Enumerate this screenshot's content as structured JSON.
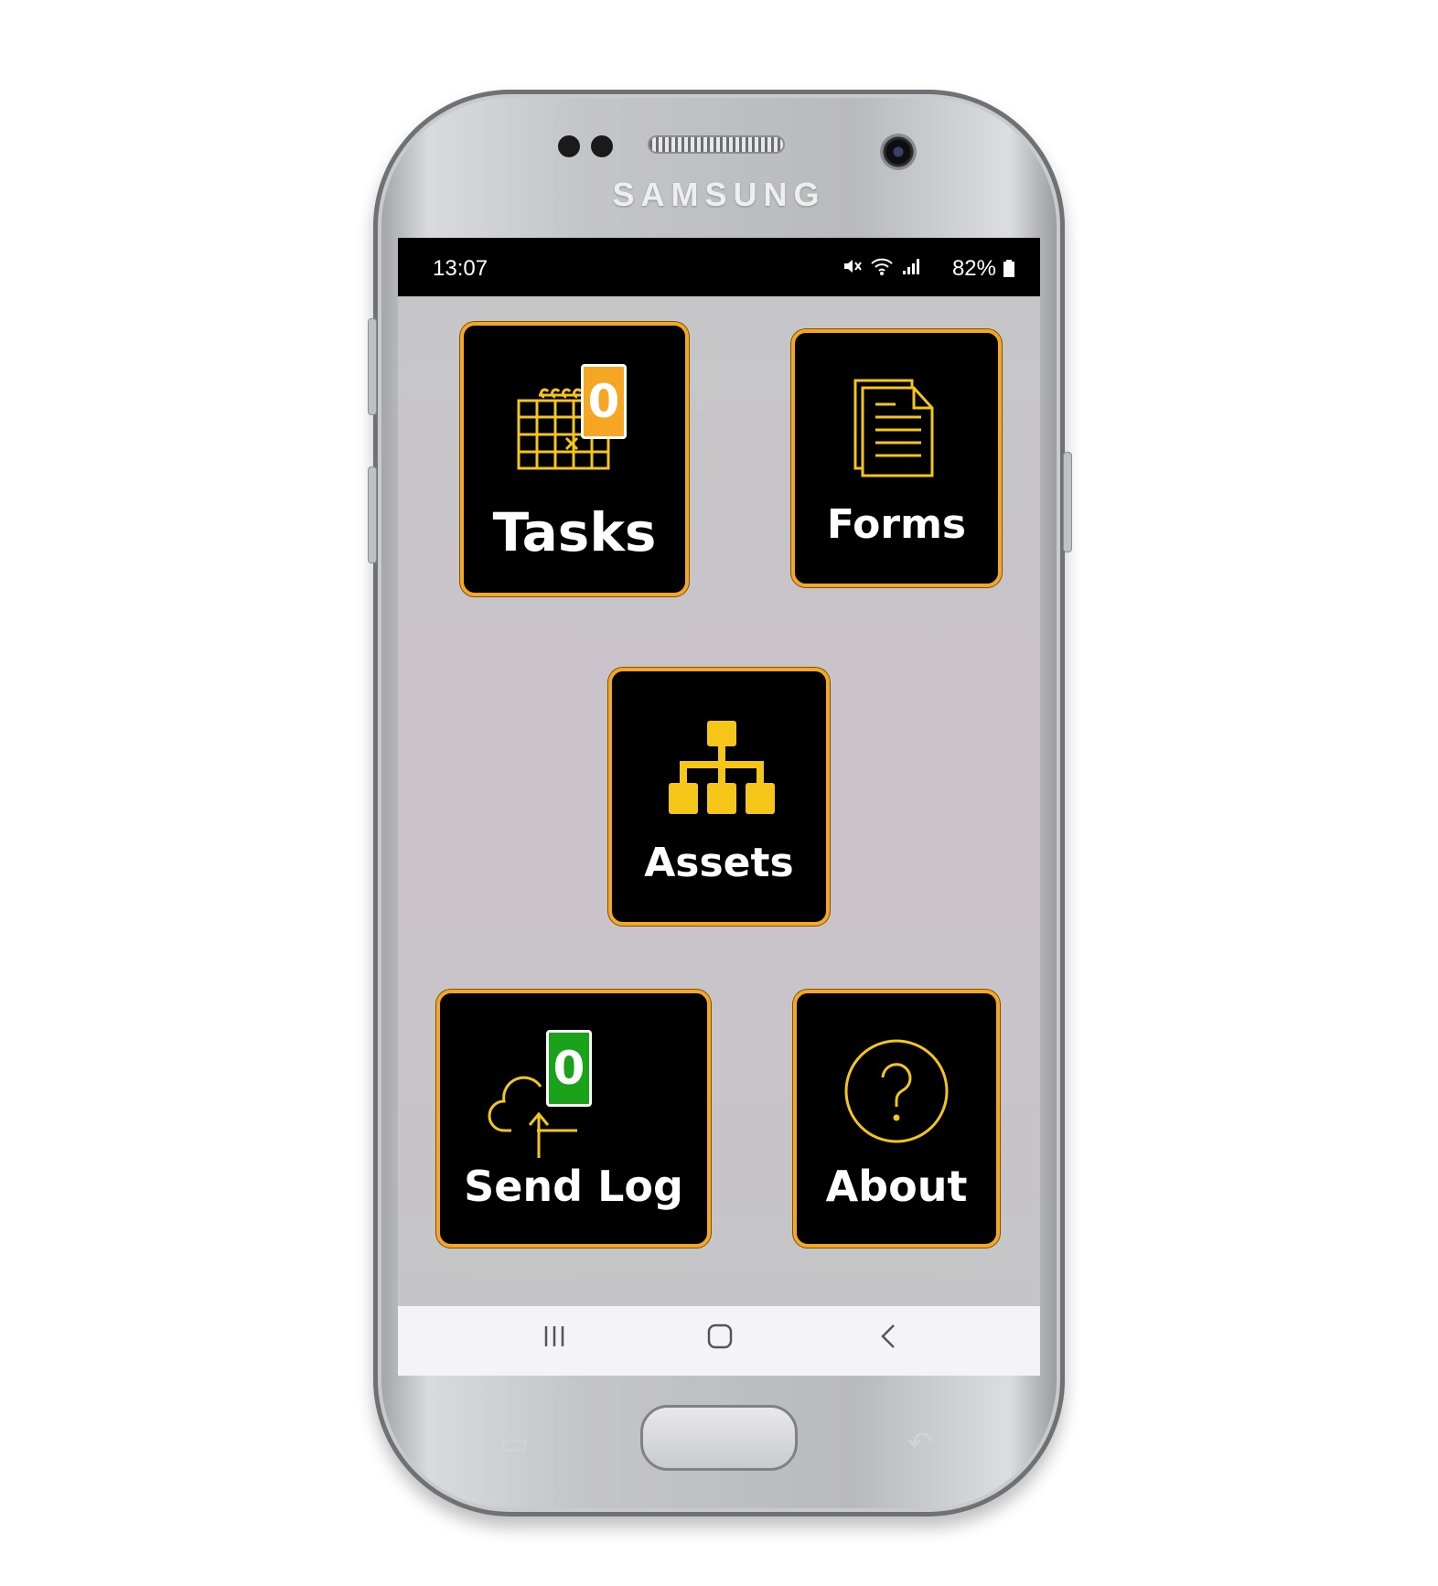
{
  "device": {
    "brand": "SAMSUNG"
  },
  "status_bar": {
    "time": "13:07",
    "battery": "82%"
  },
  "tiles": {
    "tasks": {
      "label": "Tasks",
      "badge": "0",
      "icon": "calendar-icon",
      "badge_color": "#f5a623"
    },
    "forms": {
      "label": "Forms",
      "icon": "document-icon"
    },
    "assets": {
      "label": "Assets",
      "icon": "hierarchy-icon"
    },
    "send_log": {
      "label": "Send Log",
      "badge": "0",
      "icon": "cloud-upload-icon",
      "badge_color": "#1aa31a"
    },
    "about": {
      "label": "About",
      "icon": "question-icon"
    }
  },
  "colors": {
    "accent": "#f5a623",
    "tile_bg": "#000000",
    "icon_yellow": "#f5c518"
  },
  "nav": {
    "recents": "recents-icon",
    "home": "home-icon",
    "back": "back-icon"
  }
}
